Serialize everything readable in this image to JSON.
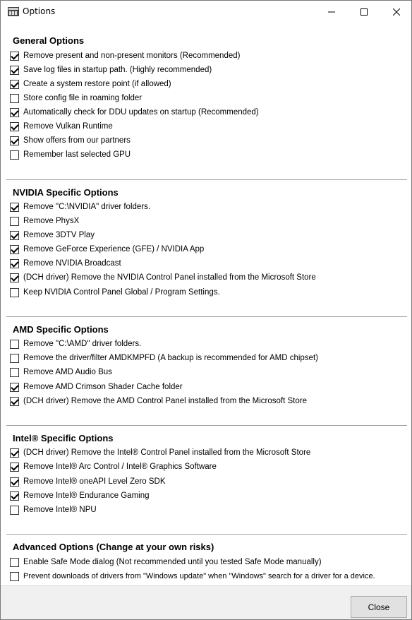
{
  "window": {
    "title": "Options",
    "icon": "ddu-app-icon"
  },
  "sections": [
    {
      "title": "General Options",
      "options": [
        {
          "label": "Remove present and non-present monitors (Recommended)",
          "checked": true
        },
        {
          "label": "Save log files in startup path. (Highly recommended)",
          "checked": true
        },
        {
          "label": "Create a system restore point (if allowed)",
          "checked": true
        },
        {
          "label": "Store config file in roaming folder",
          "checked": false
        },
        {
          "label": "Automatically check for DDU updates on startup (Recommended)",
          "checked": true
        },
        {
          "label": "Remove Vulkan Runtime",
          "checked": true
        },
        {
          "label": "Show offers from our partners",
          "checked": true
        },
        {
          "label": "Remember last selected GPU",
          "checked": false
        }
      ]
    },
    {
      "title": "NVIDIA Specific Options",
      "options": [
        {
          "label": "Remove \"C:\\NVIDIA\" driver folders.",
          "checked": true
        },
        {
          "label": "Remove PhysX",
          "checked": false
        },
        {
          "label": "Remove 3DTV Play",
          "checked": true
        },
        {
          "label": "Remove GeForce Experience (GFE) / NVIDIA App",
          "checked": true
        },
        {
          "label": "Remove NVIDIA Broadcast",
          "checked": true
        },
        {
          "label": "(DCH driver) Remove the NVIDIA Control Panel installed from the Microsoft Store",
          "checked": true
        },
        {
          "label": "Keep NVIDIA Control Panel Global / Program Settings.",
          "checked": false
        }
      ]
    },
    {
      "title": "AMD Specific Options",
      "options": [
        {
          "label": "Remove \"C:\\AMD\" driver folders.",
          "checked": false
        },
        {
          "label": "Remove the driver/filter AMDKMPFD (A backup is recommended for AMD chipset)",
          "checked": false
        },
        {
          "label": "Remove AMD Audio Bus",
          "checked": false
        },
        {
          "label": "Remove AMD Crimson Shader Cache folder",
          "checked": true
        },
        {
          "label": "(DCH driver) Remove the AMD Control Panel installed from the Microsoft Store",
          "checked": true
        }
      ]
    },
    {
      "title": "Intel® Specific Options",
      "options": [
        {
          "label": "(DCH driver) Remove the Intel® Control Panel installed from the Microsoft Store",
          "checked": true
        },
        {
          "label": "Remove Intel® Arc Control / Intel® Graphics Software",
          "checked": true
        },
        {
          "label": "Remove Intel® oneAPI Level Zero SDK",
          "checked": true
        },
        {
          "label": "Remove Intel® Endurance Gaming",
          "checked": true
        },
        {
          "label": "Remove Intel® NPU",
          "checked": false
        }
      ]
    },
    {
      "title": "Advanced Options (Change at your own risks)",
      "options": [
        {
          "label": "Enable Safe Mode dialog (Not recommended until you tested Safe Mode manually)",
          "checked": false
        },
        {
          "label": "Prevent downloads of drivers from \"Windows update\" when \"Windows\" search for a driver for a device.",
          "checked": false
        }
      ]
    }
  ],
  "footer": {
    "close_label": "Close"
  }
}
